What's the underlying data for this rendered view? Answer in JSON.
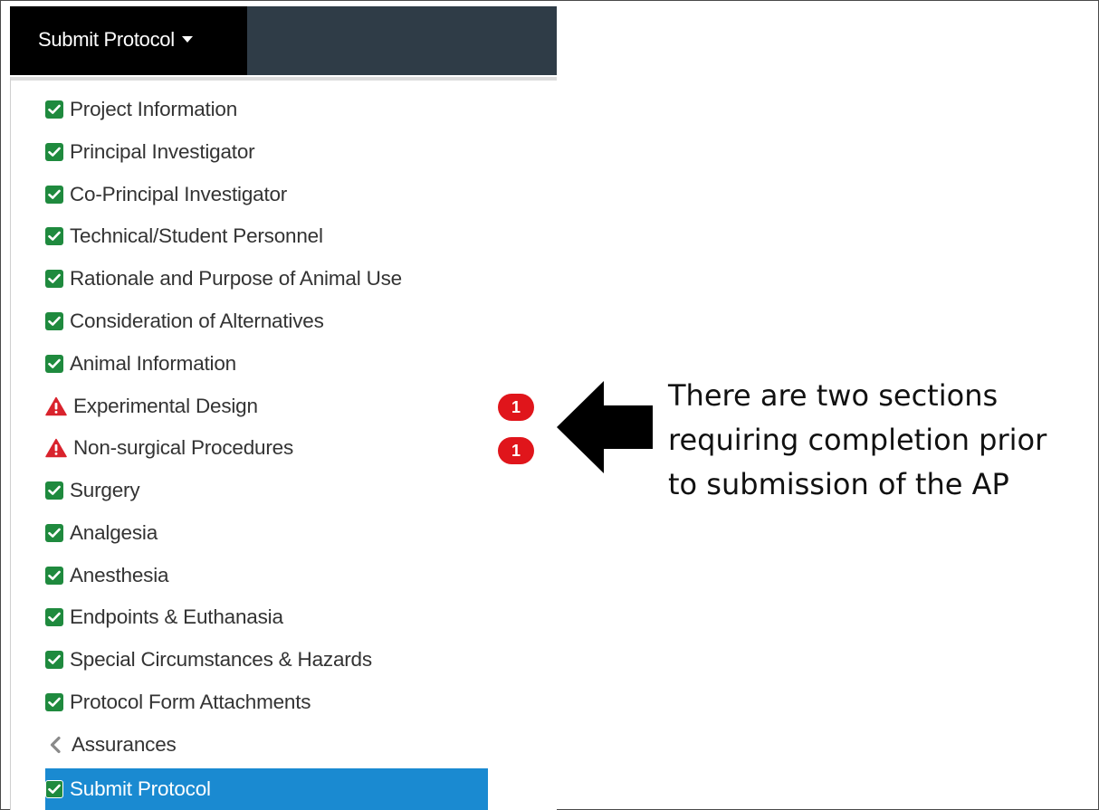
{
  "header": {
    "menu_title": "Submit Protocol"
  },
  "menu": {
    "items": [
      {
        "label": "Project Information",
        "status": "complete",
        "icon": "check-square-icon"
      },
      {
        "label": "Principal Investigator",
        "status": "complete",
        "icon": "check-square-icon"
      },
      {
        "label": "Co-Principal Investigator",
        "status": "complete",
        "icon": "check-square-icon"
      },
      {
        "label": "Technical/Student Personnel",
        "status": "complete",
        "icon": "check-square-icon"
      },
      {
        "label": "Rationale and Purpose of Animal Use",
        "status": "complete",
        "icon": "check-square-icon"
      },
      {
        "label": "Consideration of Alternatives",
        "status": "complete",
        "icon": "check-square-icon"
      },
      {
        "label": "Animal Information",
        "status": "complete",
        "icon": "check-square-icon"
      },
      {
        "label": "Experimental Design",
        "status": "incomplete",
        "icon": "warning-icon",
        "badge": "1"
      },
      {
        "label": "Non-surgical Procedures",
        "status": "incomplete",
        "icon": "warning-icon",
        "badge": "1"
      },
      {
        "label": "Surgery",
        "status": "complete",
        "icon": "check-square-icon"
      },
      {
        "label": "Analgesia",
        "status": "complete",
        "icon": "check-square-icon"
      },
      {
        "label": "Anesthesia",
        "status": "complete",
        "icon": "check-square-icon"
      },
      {
        "label": "Endpoints & Euthanasia",
        "status": "complete",
        "icon": "check-square-icon"
      },
      {
        "label": "Special Circumstances & Hazards",
        "status": "complete",
        "icon": "check-square-icon"
      },
      {
        "label": "Protocol Form Attachments",
        "status": "complete",
        "icon": "check-square-icon"
      },
      {
        "label": "Assurances",
        "status": "submenu",
        "icon": "chevron-left-icon"
      },
      {
        "label": "Submit Protocol",
        "status": "active",
        "icon": "check-square-icon"
      }
    ]
  },
  "annotation": {
    "lines": [
      "There are two sections",
      "requiring completion prior",
      "to submission of the AP"
    ]
  },
  "colors": {
    "nav_bg": "#2f3c47",
    "trigger_bg": "#000000",
    "check_green": "#1f8a3e",
    "warning_red": "#d9232d",
    "badge_red": "#e0151b",
    "active_blue": "#1a8ad1"
  }
}
